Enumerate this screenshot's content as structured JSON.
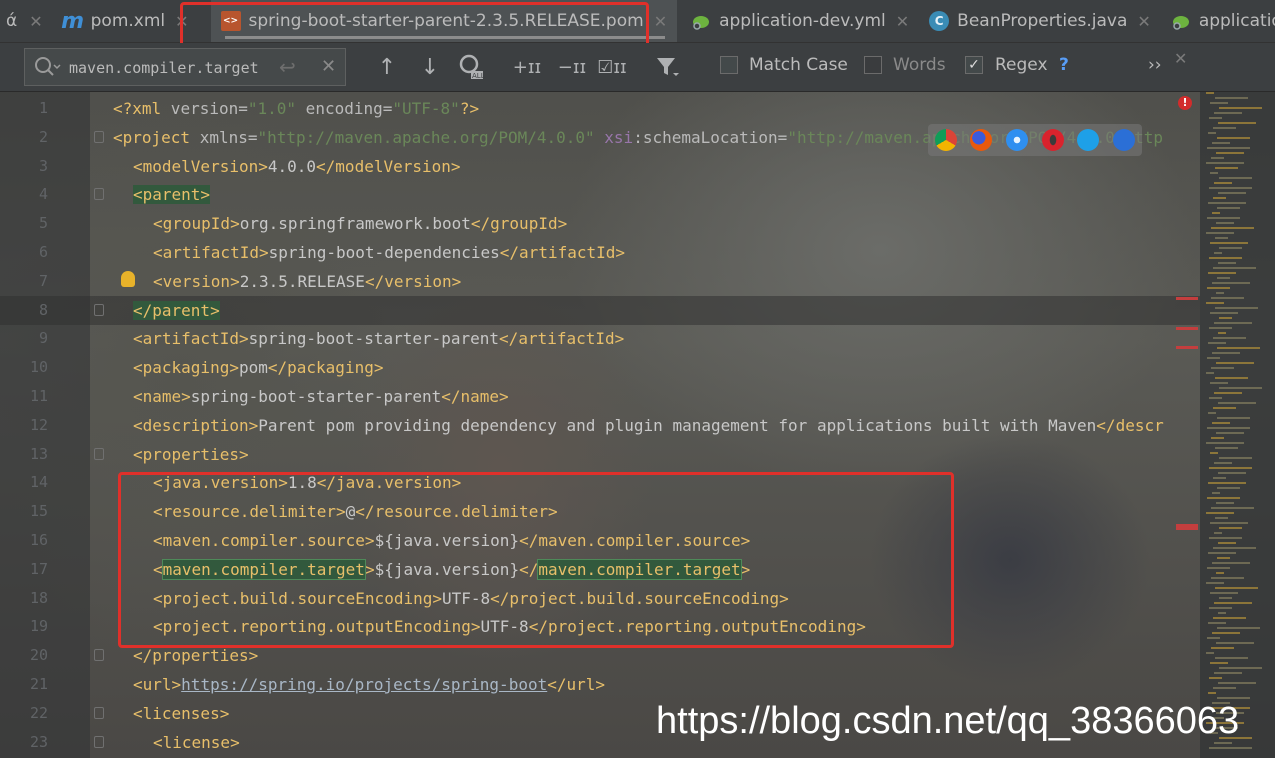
{
  "tabs": [
    {
      "label": "pom.xml",
      "icon": "m"
    },
    {
      "label": "spring-boot-starter-parent-2.3.5.RELEASE.pom",
      "icon": "<>"
    },
    {
      "label": "application-dev.yml",
      "icon": "leaf"
    },
    {
      "label": "BeanProperties.java",
      "icon": "c"
    },
    {
      "label": "application.ym",
      "icon": "leaf"
    }
  ],
  "search": {
    "value": "maven.compiler.target",
    "match_case": "Match Case",
    "words": "Words",
    "regex": "Regex",
    "help": "?",
    "more": "››"
  },
  "lines": [
    {
      "n": "1"
    },
    {
      "n": "2"
    },
    {
      "n": "3"
    },
    {
      "n": "4"
    },
    {
      "n": "5"
    },
    {
      "n": "6"
    },
    {
      "n": "7"
    },
    {
      "n": "8"
    },
    {
      "n": "9"
    },
    {
      "n": "10"
    },
    {
      "n": "11"
    },
    {
      "n": "12"
    },
    {
      "n": "13"
    },
    {
      "n": "14"
    },
    {
      "n": "15"
    },
    {
      "n": "16"
    },
    {
      "n": "17"
    },
    {
      "n": "18"
    },
    {
      "n": "19"
    },
    {
      "n": "20"
    },
    {
      "n": "21"
    },
    {
      "n": "22"
    },
    {
      "n": "23"
    }
  ],
  "code": {
    "l1": {
      "open": "<?xml",
      "a1": " version=",
      "v1": "\"1.0\"",
      "a2": " encoding=",
      "v2": "\"UTF-8\"",
      "close": "?>"
    },
    "l2": {
      "open": "<project",
      "a1": " xmlns=",
      "v1": "\"http://maven.apache.org/POM/4.0.0\"",
      "a2": " xsi",
      "a3": ":schemaLocation=",
      "v2": "\"http://maven.apache.org/POM/4.0.0 http"
    },
    "l3": {
      "t1": "<modelVersion>",
      "v": "4.0.0",
      "t2": "</modelVersion>"
    },
    "l4": {
      "t1": "<parent>"
    },
    "l5": {
      "t1": "<groupId>",
      "v": "org.springframework.boot",
      "t2": "</groupId>"
    },
    "l6": {
      "t1": "<artifactId>",
      "v": "spring-boot-dependencies",
      "t2": "</artifactId>"
    },
    "l7": {
      "t1": "<version>",
      "v": "2.3.5.RELEASE",
      "t2": "</version>"
    },
    "l8": {
      "t1": "</parent>"
    },
    "l9": {
      "t1": "<artifactId>",
      "v": "spring-boot-starter-parent",
      "t2": "</artifactId>"
    },
    "l10": {
      "t1": "<packaging>",
      "v": "pom",
      "t2": "</packaging>"
    },
    "l11": {
      "t1": "<name>",
      "v": "spring-boot-starter-parent",
      "t2": "</name>"
    },
    "l12": {
      "t1": "<description>",
      "v": "Parent pom providing dependency and plugin management for applications built with Maven",
      "t2": "</descr"
    },
    "l13": {
      "t1": "<properties>"
    },
    "l14": {
      "t1": "<java.version>",
      "v": "1.8",
      "t2": "</java.version>"
    },
    "l15": {
      "t1": "<resource.delimiter>",
      "v": "@",
      "t2": "</resource.delimiter>"
    },
    "l16": {
      "t1": "<maven.compiler.source>",
      "v": "${java.version}",
      "t2": "</maven.compiler.source>"
    },
    "l17": {
      "lt": "<",
      "t1": "maven.compiler.target",
      "gt": ">",
      "v": "${java.version}",
      "lt2": "</",
      "t2": "maven.compiler.target",
      "gt2": ">"
    },
    "l18": {
      "t1": "<project.build.sourceEncoding>",
      "v": "UTF-8",
      "t2": "</project.build.sourceEncoding>"
    },
    "l19": {
      "t1": "<project.reporting.outputEncoding>",
      "v": "UTF-8",
      "t2": "</project.reporting.outputEncoding>"
    },
    "l20": {
      "t1": "</properties>"
    },
    "l21": {
      "t1": "<url>",
      "v": "https://spring.io/projects/spring-boot",
      "t2": "</url>"
    },
    "l22": {
      "t1": "<licenses>"
    },
    "l23": {
      "t1": "<license>"
    }
  },
  "watermark": "https://blog.csdn.net/qq_38366063",
  "colors": {
    "highlight_box": "#e0302a",
    "tag": "#e8bf6a",
    "attr_value": "#6a8759",
    "match": "#32593d"
  }
}
